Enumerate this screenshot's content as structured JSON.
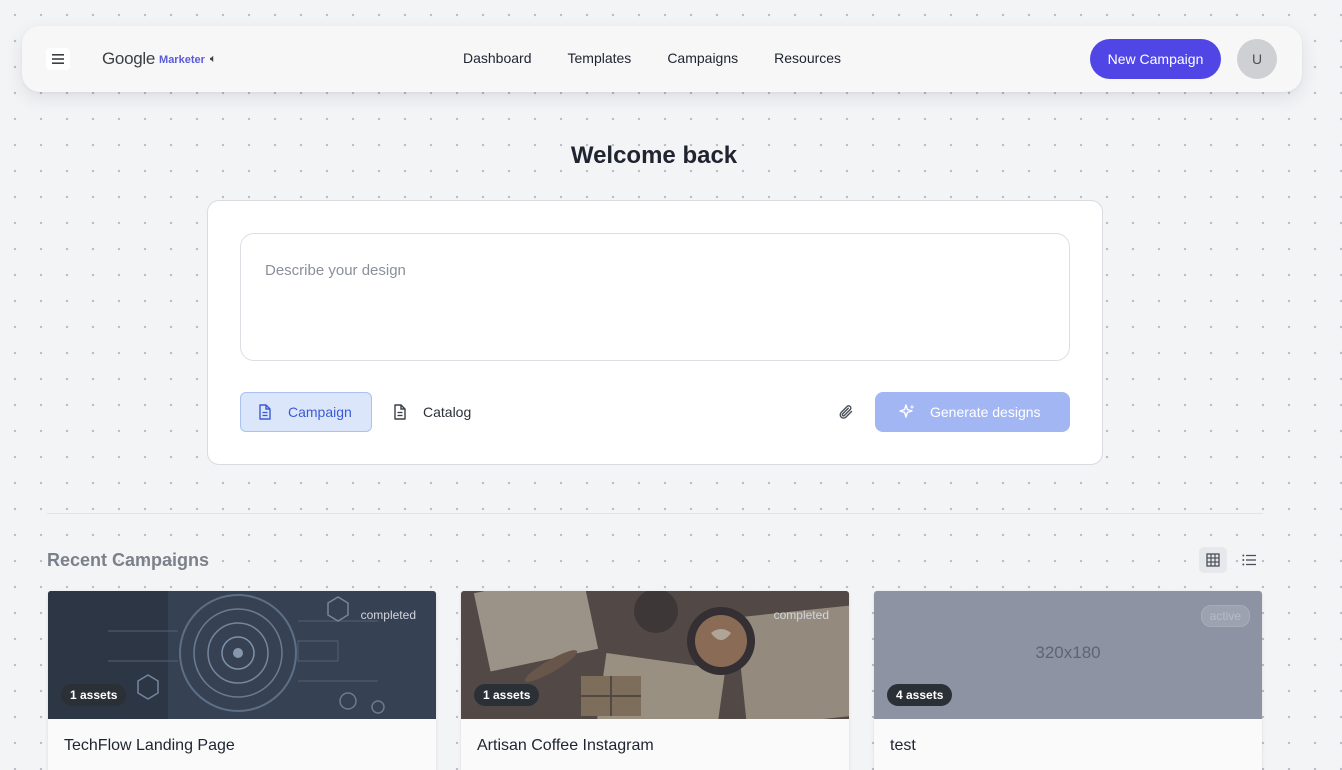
{
  "header": {
    "brand_google": "Google",
    "brand_product": "Marketer",
    "brand_icon": "speaker-icon",
    "nav": [
      "Dashboard",
      "Templates",
      "Campaigns",
      "Resources"
    ],
    "new_campaign_label": "New Campaign",
    "avatar_initial": "U"
  },
  "welcome_title": "Welcome back",
  "composer": {
    "placeholder": "Describe your design",
    "modes": [
      {
        "label": "Campaign",
        "icon": "document-icon",
        "selected": true
      },
      {
        "label": "Catalog",
        "icon": "document-icon",
        "selected": false
      }
    ],
    "attach_icon": "paperclip-icon",
    "generate_label": "Generate designs",
    "generate_icon": "sparkle-icon"
  },
  "recent": {
    "title": "Recent Campaigns",
    "view_modes": [
      "grid-view-icon",
      "list-view-icon"
    ],
    "campaigns": [
      {
        "title": "TechFlow Landing Page",
        "status": "completed",
        "assets": "1 assets",
        "thumbnail": "tech-dashboard-image"
      },
      {
        "title": "Artisan Coffee Instagram",
        "status": "completed",
        "assets": "1 assets",
        "thumbnail": "coffee-flatlay-image"
      },
      {
        "title": "test",
        "status": "active",
        "assets": "4 assets",
        "thumbnail": "placeholder",
        "placeholder_text": "320x180"
      }
    ]
  },
  "colors": {
    "accent": "#4f46e5",
    "generate_disabled": "#a3b6f4",
    "selected_mode_bg": "#dbe6fb",
    "page_bg": "#f3f4f6"
  }
}
